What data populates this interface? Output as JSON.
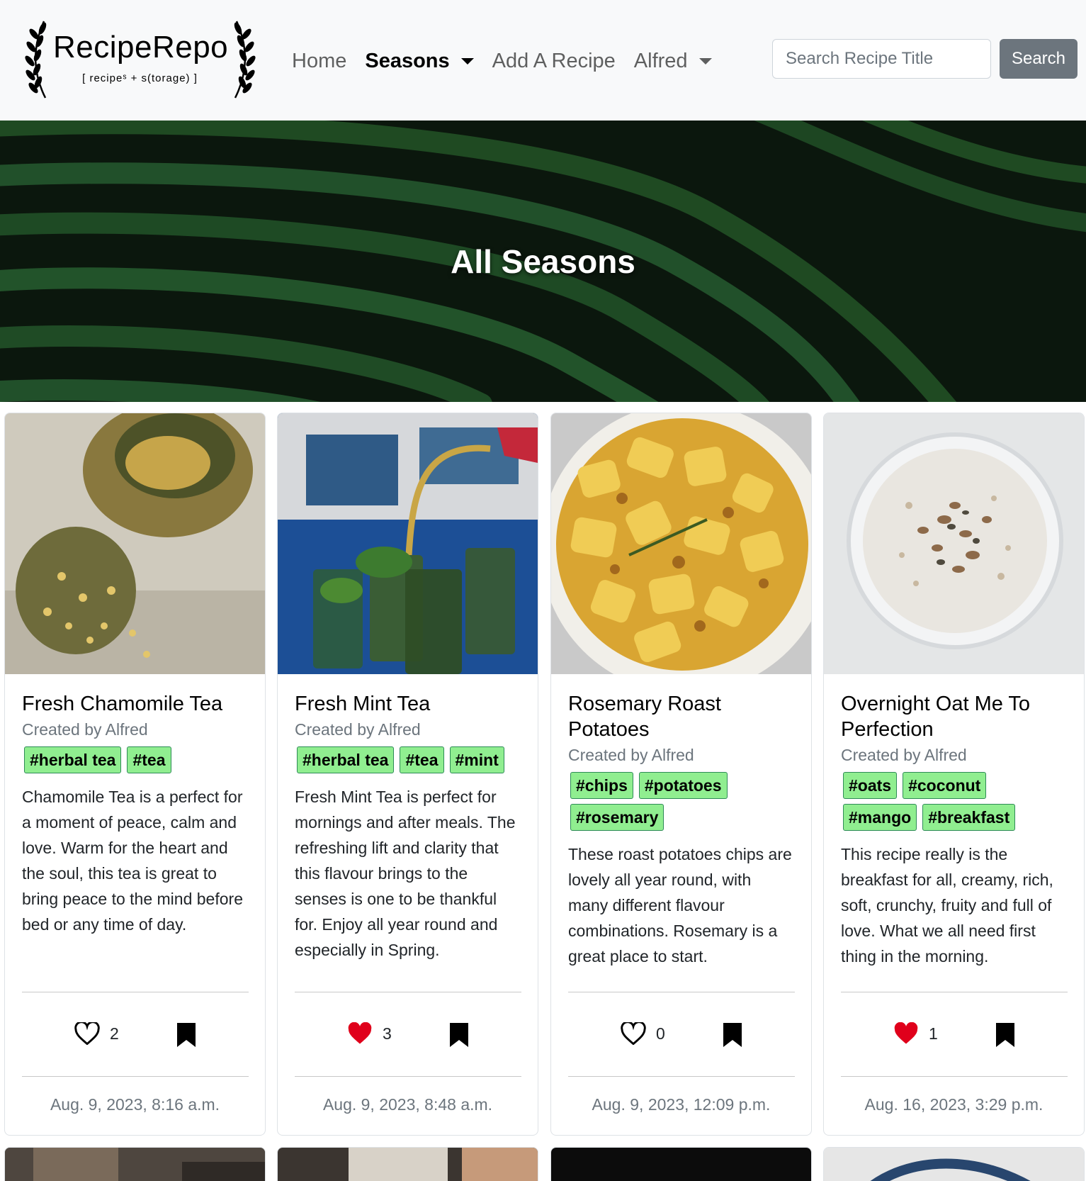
{
  "brand": {
    "name": "RecipeRepo",
    "tagline": "[ recipeˢ + s(torage) ]"
  },
  "nav": {
    "home": "Home",
    "seasons": "Seasons",
    "add_recipe": "Add A Recipe",
    "user": "Alfred"
  },
  "search": {
    "placeholder": "Search Recipe Title",
    "button": "Search"
  },
  "hero": {
    "title": "All Seasons"
  },
  "recipes": [
    {
      "title": "Fresh Chamomile Tea",
      "author": "Created by Alfred",
      "tags": [
        "#herbal tea",
        "#tea"
      ],
      "description": "Chamomile Tea is a perfect for a moment of peace, calm and love. Warm for the heart and the soul, this tea is great to bring peace to the mind before bed or any time of day.",
      "likes": "2",
      "liked": false,
      "date": "Aug. 9, 2023, 8:16 a.m."
    },
    {
      "title": "Fresh Mint Tea",
      "author": "Created by Alfred",
      "tags": [
        "#herbal tea",
        "#tea",
        "#mint"
      ],
      "description": "Fresh Mint Tea is perfect for mornings and after meals. The refreshing lift and clarity that this flavour brings to the senses is one to be thankful for. Enjoy all year round and especially in Spring.",
      "likes": "3",
      "liked": true,
      "date": "Aug. 9, 2023, 8:48 a.m."
    },
    {
      "title": "Rosemary Roast Potatoes",
      "author": "Created by Alfred",
      "tags": [
        "#chips",
        "#potatoes",
        "#rosemary"
      ],
      "description": "These roast potatoes chips are lovely all year round, with many different flavour combinations. Rosemary is a great place to start.",
      "likes": "0",
      "liked": false,
      "date": "Aug. 9, 2023, 12:09 p.m."
    },
    {
      "title": "Overnight Oat Me To Perfection",
      "author": "Created by Alfred",
      "tags": [
        "#oats",
        "#coconut",
        "#mango",
        "#breakfast"
      ],
      "description": "This recipe really is the breakfast for all, creamy, rich, soft, crunchy, fruity and full of love. What we all need first thing in the morning.",
      "likes": "1",
      "liked": true,
      "date": "Aug. 16, 2023, 3:29 p.m."
    }
  ],
  "colors": {
    "tag_bg": "#90ee90",
    "liked": "#e0001b",
    "search_btn": "#6c757d",
    "navbar_bg": "#f8f9fa"
  }
}
